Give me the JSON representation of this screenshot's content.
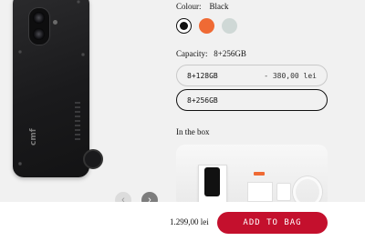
{
  "options": {
    "colour_label": "Colour:",
    "colour_value": "Black",
    "colours": [
      {
        "name": "Black",
        "hex": "#111111",
        "selected": true
      },
      {
        "name": "Orange",
        "hex": "#ef6a34",
        "selected": false
      },
      {
        "name": "White",
        "hex": "#cfd8d6",
        "selected": false
      }
    ],
    "capacity_label": "Capacity:",
    "capacity_value": "8+256GB",
    "capacities": [
      {
        "label": "8+128GB",
        "price_delta": "- 380,00 lei",
        "selected": false
      },
      {
        "label": "8+256GB",
        "price_delta": "",
        "selected": true
      }
    ]
  },
  "in_the_box": {
    "title": "In the box"
  },
  "gallery": {
    "prev_icon": "chevron-left-icon",
    "next_icon": "chevron-right-icon",
    "brand_mark": "cmf"
  },
  "purchase": {
    "price": "1.299,00 lei",
    "add_to_bag_label": "ADD TO BAG",
    "accent_color": "#c4102d"
  }
}
